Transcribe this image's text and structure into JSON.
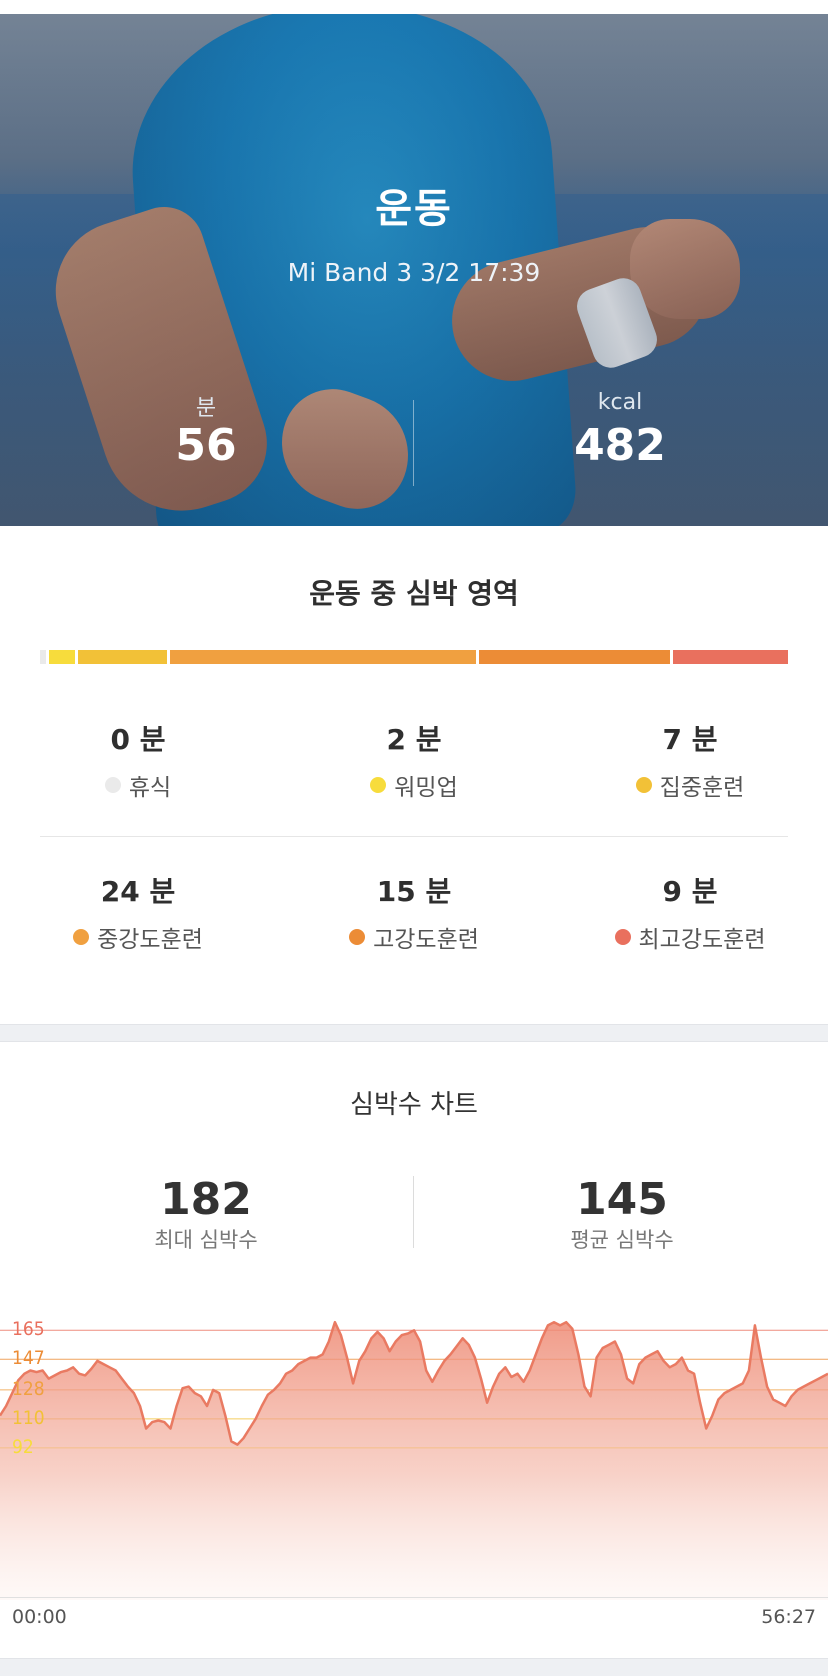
{
  "hero": {
    "title": "운동",
    "subtitle": "Mi Band 3 3/2 17:39",
    "duration_unit": "분",
    "duration_value": "56",
    "calories_unit": "kcal",
    "calories_value": "482"
  },
  "zones": {
    "title": "운동 중 심박 영역",
    "items": [
      {
        "minutes": "0 분",
        "label": "휴식",
        "color": "#eaeaea"
      },
      {
        "minutes": "2 분",
        "label": "워밍업",
        "color": "#f7dc3c"
      },
      {
        "minutes": "7 분",
        "label": "집중훈련",
        "color": "#f2c137"
      },
      {
        "minutes": "24 분",
        "label": "중강도훈련",
        "color": "#f0a040"
      },
      {
        "minutes": "15 분",
        "label": "고강도훈련",
        "color": "#ec8c36"
      },
      {
        "minutes": "9 분",
        "label": "최고강도훈련",
        "color": "#e9705e"
      }
    ],
    "bar_minutes": [
      0.5,
      2,
      7,
      24,
      15,
      9
    ]
  },
  "heart": {
    "title": "심박수 차트",
    "max_value": "182",
    "max_label": "최대 심박수",
    "avg_value": "145",
    "avg_label": "평균 심박수"
  },
  "chart_data": {
    "type": "area",
    "title": "",
    "xlabel": "",
    "ylabel": "",
    "x_start": "00:00",
    "x_end": "56:27",
    "ylim": [
      0,
      190
    ],
    "reference_lines": [
      {
        "label": "165",
        "value": 165,
        "color": "#e9705e"
      },
      {
        "label": "147",
        "value": 147,
        "color": "#ec8c36"
      },
      {
        "label": "128",
        "value": 128,
        "color": "#f0a040"
      },
      {
        "label": "110",
        "value": 110,
        "color": "#f2c137"
      },
      {
        "label": "92",
        "value": 92,
        "color": "#f7dc3c"
      }
    ],
    "series": [
      {
        "values": [
          112,
          118,
          126,
          134,
          138,
          140,
          139,
          140,
          135,
          137,
          139,
          140,
          142,
          138,
          137,
          141,
          146,
          144,
          142,
          140,
          135,
          130,
          126,
          118,
          104,
          108,
          109,
          108,
          104,
          118,
          129,
          130,
          126,
          124,
          118,
          128,
          126,
          112,
          96,
          94,
          98,
          104,
          110,
          118,
          125,
          128,
          132,
          138,
          140,
          144,
          146,
          148,
          148,
          150,
          158,
          170,
          162,
          148,
          132,
          146,
          152,
          160,
          164,
          160,
          152,
          158,
          162,
          163,
          165,
          158,
          140,
          133,
          140,
          146,
          150,
          155,
          160,
          156,
          148,
          135,
          120,
          130,
          138,
          142,
          136,
          138,
          133,
          140,
          150,
          160,
          168,
          170,
          168,
          170,
          166,
          150,
          130,
          124,
          148,
          154,
          156,
          158,
          150,
          135,
          132,
          144,
          148,
          150,
          152,
          146,
          142,
          144,
          148,
          140,
          138,
          120,
          104,
          112,
          122,
          126,
          128,
          130,
          132,
          140,
          168,
          148,
          130,
          122,
          120,
          118,
          124,
          128,
          130,
          132,
          134,
          136,
          138
        ]
      }
    ]
  }
}
